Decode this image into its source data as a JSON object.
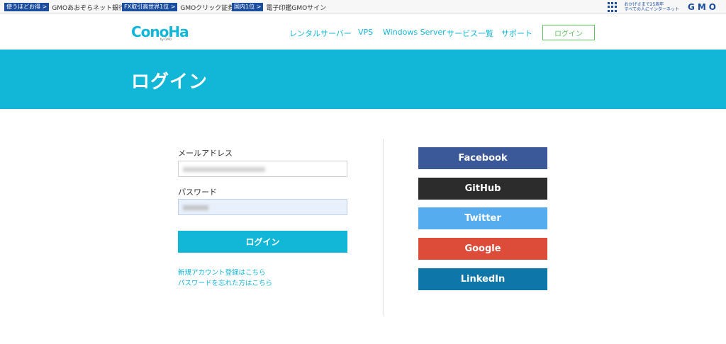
{
  "gmo_bar": {
    "links": [
      {
        "tag": "使うほどお得 >",
        "text": "GMOあおぞらネット銀行"
      },
      {
        "tag": "FX取引高世界1位 >",
        "text": "GMOクリック証券"
      },
      {
        "tag": "国内1位 >",
        "text": "電子印鑑GMOサイン"
      }
    ],
    "tagline_1": "おかげさまで25周年",
    "tagline_2": "すべての人にインターネット",
    "logo": "GMO",
    "brand_color": "#1a4d9e"
  },
  "header": {
    "logo_text": "ConoHa",
    "logo_sub": "by GMO",
    "nav": [
      "レンタルサーバー",
      "VPS",
      "Windows Server",
      "サービス一覧",
      "サポート"
    ],
    "login_button": "ログイン",
    "accent_color": "#12b6d6"
  },
  "banner": {
    "title": "ログイン"
  },
  "form": {
    "email_label": "メールアドレス",
    "password_label": "パスワード",
    "submit_label": "ログイン",
    "register_link": "新規アカウント登録はこちら",
    "forgot_link": "パスワードを忘れた方はこちら"
  },
  "social": [
    {
      "label": "Facebook",
      "color": "#3b5998"
    },
    {
      "label": "GitHub",
      "color": "#2c2c2c"
    },
    {
      "label": "Twitter",
      "color": "#55acee"
    },
    {
      "label": "Google",
      "color": "#dd4b39"
    },
    {
      "label": "LinkedIn",
      "color": "#0e76a8"
    }
  ]
}
